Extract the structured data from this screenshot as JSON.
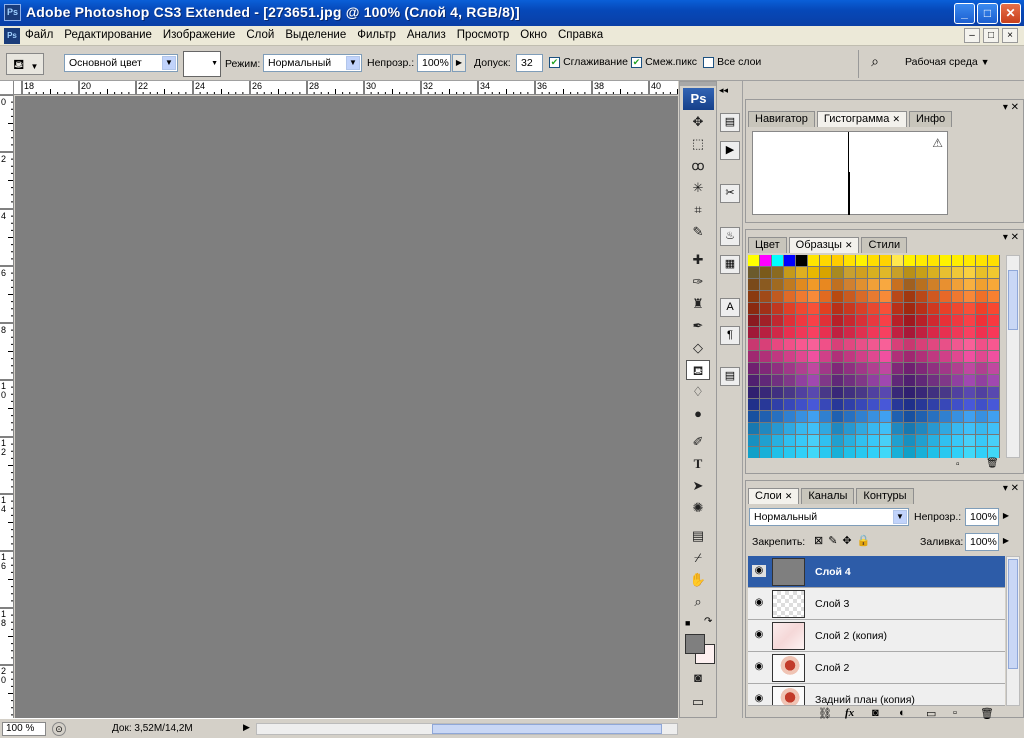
{
  "window": {
    "title": "Adobe Photoshop CS3 Extended - [273651.jpg @ 100% (Слой 4, RGB/8)]",
    "app_icon_label": "Ps",
    "minimize": "_",
    "maximize": "□",
    "close": "✕"
  },
  "menu": {
    "items": [
      "Файл",
      "Редактирование",
      "Изображение",
      "Слой",
      "Выделение",
      "Фильтр",
      "Анализ",
      "Просмотр",
      "Окно",
      "Справка"
    ],
    "doc_controls": [
      "–",
      "□",
      "×"
    ]
  },
  "options": {
    "fill_source": "Основной цвет",
    "mode_label": "Режим:",
    "mode_value": "Нормальный",
    "opacity_label": "Непрозр.:",
    "opacity_value": "100%",
    "tolerance_label": "Допуск:",
    "tolerance_value": "32",
    "antialias_label": "Сглаживание",
    "antialias_checked": true,
    "contiguous_label": "Смеж.пикс",
    "contiguous_checked": true,
    "all_layers_label": "Все слои",
    "all_layers_checked": false,
    "workspace_label": "Рабочая среда"
  },
  "rulers": {
    "top_labels": [
      "18",
      "20",
      "22",
      "24",
      "26",
      "28",
      "30",
      "32",
      "34",
      "36",
      "38",
      "40"
    ],
    "left_labels": [
      "0",
      "2",
      "4",
      "6",
      "8",
      "1 0",
      "1 2",
      "1 4",
      "1 6",
      "1 8",
      "2 0"
    ]
  },
  "canvas": {
    "color": "#7f7f7f"
  },
  "status": {
    "zoom": "100 %",
    "doc_info": "Док: 3,52M/14,2M"
  },
  "toolbox": {
    "logo": "Ps",
    "tools": [
      "move-tool",
      "marquee-tool",
      "lasso-tool",
      "magic-wand-tool",
      "crop-tool",
      "slice-tool",
      "healing-brush-tool",
      "brush-tool",
      "clone-stamp-tool",
      "history-brush-tool",
      "eraser-tool",
      "paint-bucket-tool",
      "blur-tool",
      "dodge-tool",
      "pen-tool",
      "type-tool",
      "path-selection-tool",
      "shape-tool",
      "notes-tool",
      "eyedropper-tool",
      "hand-tool",
      "zoom-tool"
    ],
    "foreground_color": "#7f7f7f",
    "background_color": "#fdf0f0"
  },
  "panels": {
    "navigator": {
      "tabs": [
        "Навигатор",
        "Гистограмма",
        "Инфо"
      ],
      "active_tab": "Гистограмма"
    },
    "swatches": {
      "tabs": [
        "Цвет",
        "Образцы",
        "Стили"
      ],
      "active_tab": "Образцы"
    },
    "layers": {
      "tabs": [
        "Слои",
        "Каналы",
        "Контуры"
      ],
      "active_tab": "Слои",
      "blend_mode": "Нормальный",
      "opacity_label": "Непрозр.:",
      "opacity_value": "100%",
      "lock_label": "Закрепить:",
      "fill_label": "Заливка:",
      "fill_value": "100%",
      "items": [
        {
          "name": "Слой 4",
          "selected": true,
          "thumb": "gray"
        },
        {
          "name": "Слой 3",
          "selected": false,
          "thumb": "transparent"
        },
        {
          "name": "Слой 2 (копия)",
          "selected": false,
          "thumb": "faded-photo"
        },
        {
          "name": "Слой 2",
          "selected": false,
          "thumb": "photo"
        },
        {
          "name": "Задний план (копия)",
          "selected": false,
          "thumb": "photo"
        }
      ],
      "footer_icons": [
        "link-icon",
        "fx-icon",
        "mask-icon",
        "adjustment-icon",
        "group-icon",
        "new-layer-icon",
        "trash-icon"
      ]
    }
  }
}
